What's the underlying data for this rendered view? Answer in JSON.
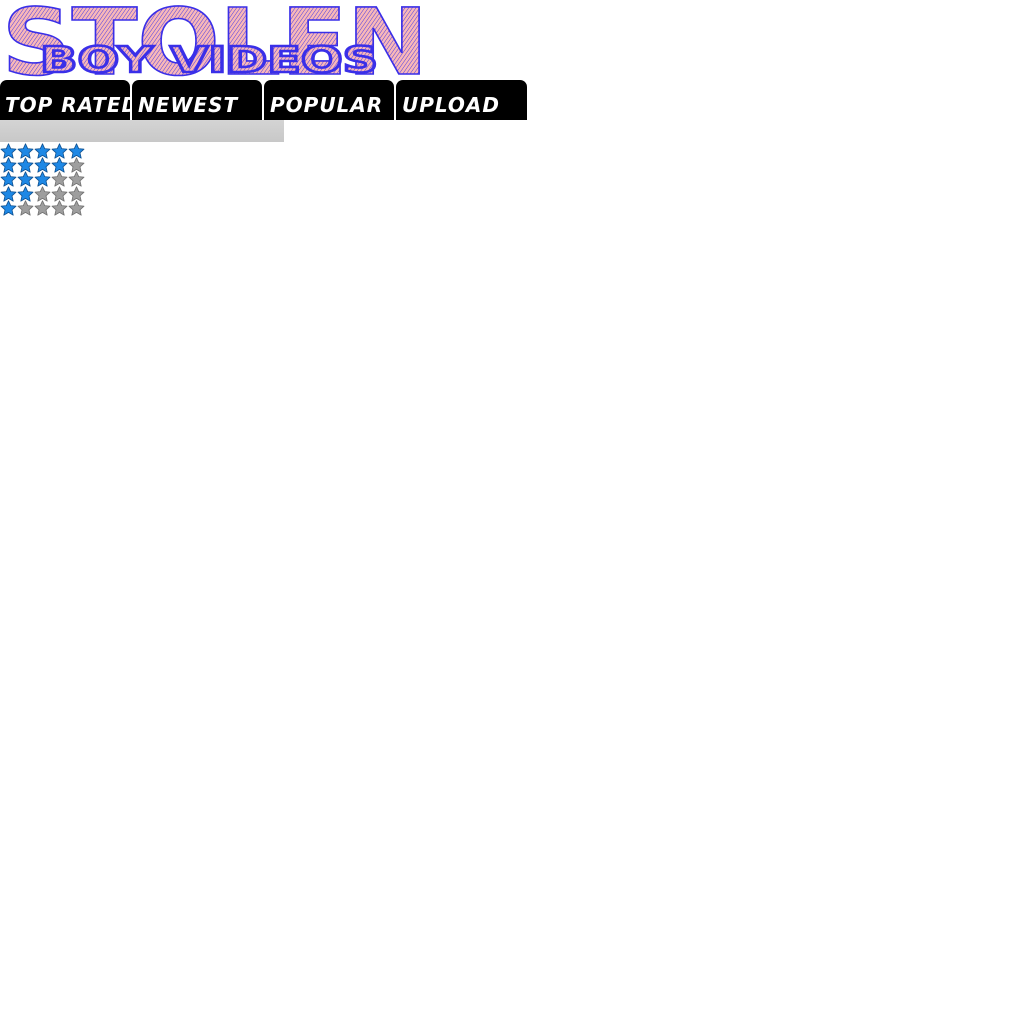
{
  "logo": {
    "line1": "STOLEN",
    "line2": "BOY VIDEOS",
    "fill_color": "#f9b8b8",
    "stroke_color": "#3a2fe8"
  },
  "nav": {
    "tabs": [
      {
        "label": "TOP RATED"
      },
      {
        "label": "NEWEST"
      },
      {
        "label": "POPULAR"
      },
      {
        "label": "UPLOAD"
      }
    ],
    "bg_color": "#000000",
    "text_color": "#ffffff"
  },
  "ratings": {
    "max": 5,
    "rows": [
      {
        "filled": 5
      },
      {
        "filled": 4
      },
      {
        "filled": 3
      },
      {
        "filled": 2
      },
      {
        "filled": 1
      }
    ],
    "filled_color": "#1e88e5",
    "empty_color": "#9e9e9e"
  }
}
